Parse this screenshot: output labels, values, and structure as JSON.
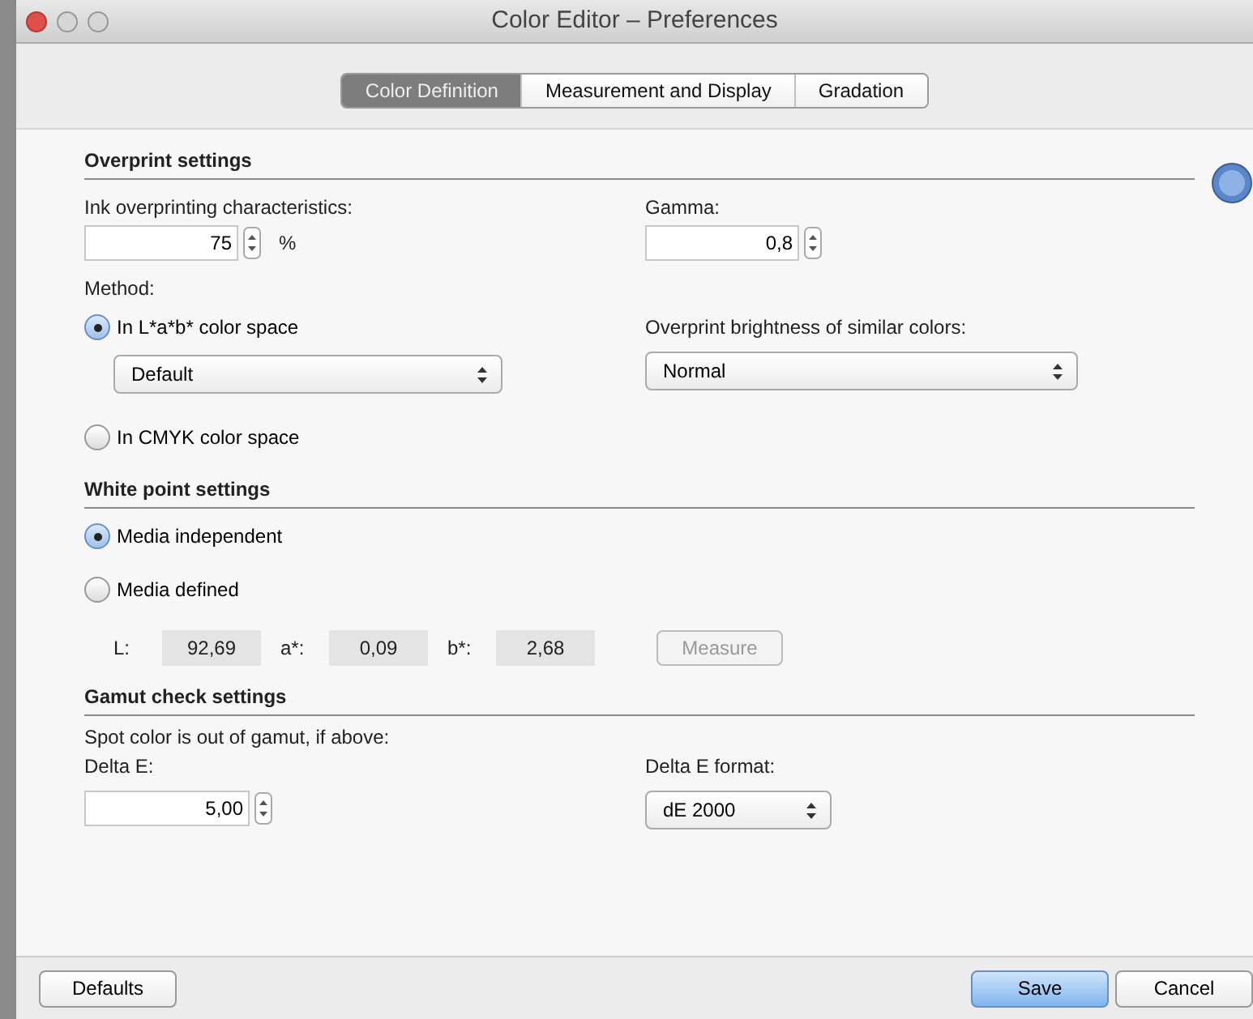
{
  "window": {
    "title": "Color Editor – Preferences"
  },
  "tabs": [
    {
      "label": "Color Definition",
      "selected": true
    },
    {
      "label": "Measurement and Display",
      "selected": false
    },
    {
      "label": "Gradation",
      "selected": false
    }
  ],
  "overprint": {
    "title": "Overprint settings",
    "ink": {
      "label": "Ink overprinting characteristics:",
      "value": "75",
      "unit": "%"
    },
    "gamma": {
      "label": "Gamma:",
      "value": "0,8"
    },
    "method": {
      "label": "Method:",
      "options": [
        {
          "label": "In L*a*b* color space",
          "selected": true,
          "dropdown": "Default"
        },
        {
          "label": "In CMYK color space",
          "selected": false
        }
      ]
    },
    "brightness": {
      "label": "Overprint brightness of similar colors:",
      "value": "Normal"
    }
  },
  "white_point": {
    "title": "White point settings",
    "options": [
      {
        "label": "Media independent",
        "selected": true
      },
      {
        "label": "Media defined",
        "selected": false
      }
    ],
    "lab_values": [
      {
        "label": "L:",
        "value": "92,69"
      },
      {
        "label": "a*:",
        "value": "0,09"
      },
      {
        "label": "b*:",
        "value": "2,68"
      }
    ],
    "measure_button": {
      "label": "Measure",
      "disabled": true
    }
  },
  "gamut": {
    "title": "Gamut check settings",
    "note": "Spot color is out of gamut, if above:",
    "delta_e": {
      "label": "Delta E:",
      "value": "5,00"
    },
    "delta_e_format": {
      "label": "Delta E format:",
      "value": "dE 2000"
    }
  },
  "footer": {
    "left_buttons": [
      {
        "label": "Defaults",
        "default": false
      }
    ],
    "right_buttons": [
      {
        "label": "Save",
        "default": true
      },
      {
        "label": "Cancel",
        "default": false
      }
    ]
  }
}
